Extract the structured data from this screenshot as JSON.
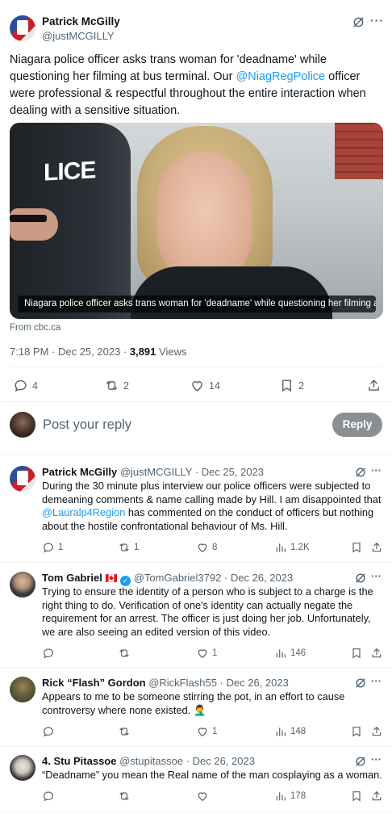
{
  "main_tweet": {
    "author_name": "Patrick McGilly",
    "author_handle": "@justMCGILLY",
    "text_before_mention": "Niagara police officer asks trans woman for 'deadname' while questioning her filming at bus terminal. Our ",
    "mention": "@NiagRegPolice",
    "text_after_mention": " officer were professional & respectful throughout the entire interaction when dealing with a sensitive situation.",
    "media_label": "LICE",
    "media_caption": "Niagara police officer asks trans woman for 'deadname' while questioning her filming a...",
    "source": "From cbc.ca",
    "time_date": "7:18 PM · Dec 25, 2023 · ",
    "views_count": "3,891",
    "views_label": " Views",
    "replies": "4",
    "reposts": "2",
    "likes": "14",
    "bookmarks": "2"
  },
  "composer": {
    "placeholder": "Post your reply",
    "reply_button": "Reply"
  },
  "replies": [
    {
      "name": "Patrick McGilly",
      "flag": "",
      "verified": false,
      "handle_date": "@justMCGILLY · Dec 25, 2023",
      "text_before_mention": "During the 30 minute plus interview our police officers were subjected to demeaning comments & name calling made by Hill. I am disappointed that ",
      "mention": "@Lauralp4Region",
      "text_after_mention": " has commented on the conduct of officers but nothing about the hostile confrontational behaviour of Ms. Hill.",
      "replies": "1",
      "reposts": "1",
      "likes": "8",
      "views": "1.2K"
    },
    {
      "name": "Tom Gabriel",
      "flag": "🇨🇦",
      "verified": true,
      "handle_date": "@TomGabriel3792 · Dec 26, 2023",
      "text_before_mention": "Trying to ensure the identity of a person who is subject to a charge is the right thing to do. Verification of one's identity can actually negate the requirement for an arrest. The officer is just doing her job. Unfortunately, we are also seeing an edited version of this video.",
      "mention": "",
      "text_after_mention": "",
      "replies": "",
      "reposts": "",
      "likes": "1",
      "views": "146"
    },
    {
      "name": "Rick “Flash” Gordon",
      "flag": "",
      "verified": false,
      "handle_date": "@RickFlash55 · Dec 26, 2023",
      "text_before_mention": "Appears to me to be someone stirring the pot, in an effort to cause controversy where none existed. 🤦‍♂️",
      "mention": "",
      "text_after_mention": "",
      "replies": "",
      "reposts": "",
      "likes": "1",
      "views": "148"
    },
    {
      "name": "4. Stu Pitassoe",
      "flag": "",
      "verified": false,
      "handle_date": "@stupitassoe · Dec 26, 2023",
      "text_before_mention": "“Deadname” you mean the Real name of the man cosplaying as a woman.",
      "mention": "",
      "text_after_mention": "",
      "replies": "",
      "reposts": "",
      "likes": "",
      "views": "178"
    }
  ],
  "colors": {
    "accent": "#1d9bf0",
    "muted": "#536471",
    "reply_button_bg": "#8b8f93"
  }
}
